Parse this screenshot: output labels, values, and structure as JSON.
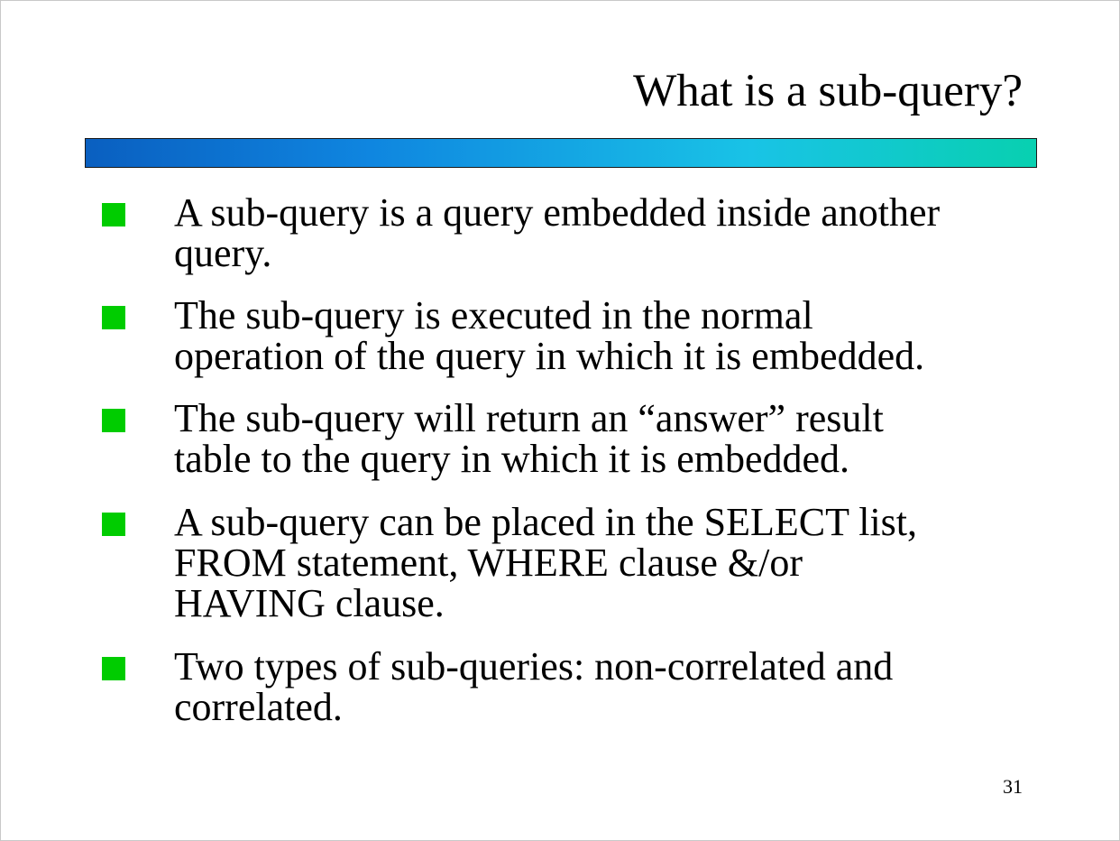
{
  "slide": {
    "title": "What is a sub-query?",
    "accent_bar_colors": [
      "#0a5fc0",
      "#0f86e0",
      "#19c3e6",
      "#08d0b0"
    ],
    "bullet_color": "#00cc00",
    "bullets": [
      {
        "text": "A sub-query is a query embedded inside another\nquery."
      },
      {
        "text": "The sub-query is executed in the normal\noperation of the query in which it is embedded."
      },
      {
        "text": "The sub-query will return an “answer” result\ntable to the query in which it is embedded."
      },
      {
        "text": "A sub-query can be placed in the SELECT list,\nFROM statement, WHERE clause &/or\nHAVING clause."
      },
      {
        "text": "Two types of sub-queries:  non-correlated and\ncorrelated."
      }
    ],
    "page_number": "31"
  }
}
